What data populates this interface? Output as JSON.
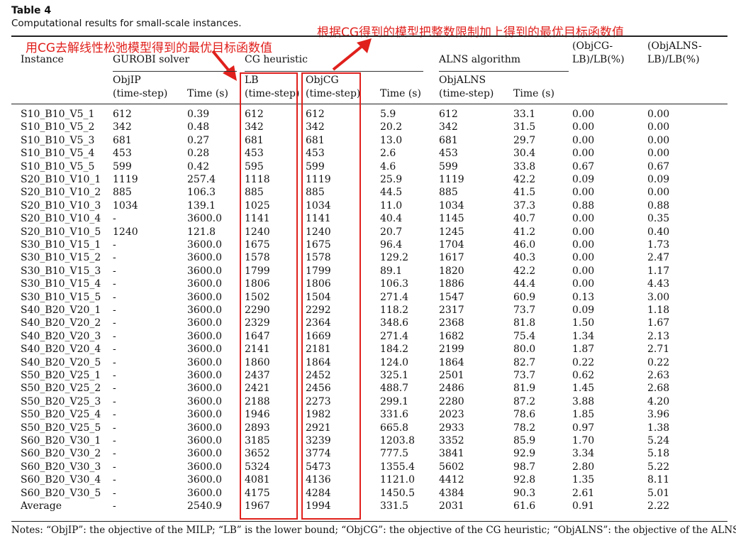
{
  "caption": {
    "label": "Table 4",
    "title": "Computational results for small-scale instances."
  },
  "annotations": {
    "left": "用CG去解线性松弛模型得到的最优目标函数值",
    "right": "根据CG得到的模型把整数限制加上得到的最优目标函数值",
    "color": "#e0201c"
  },
  "header": {
    "instance": "Instance",
    "gurobi": "GUROBI solver",
    "cg": "CG heuristic",
    "alns": "ALNS algorithm",
    "gap_cg_l1": "(ObjCG-",
    "gap_cg_l2": "LB)/LB(%)",
    "gap_alns_l1": "(ObjALNS-",
    "gap_alns_l2": "LB)/LB(%)",
    "objip_l1": "ObjIP",
    "objip_l2": "(time-step)",
    "time": "Time (s)",
    "lb_l1": "LB",
    "lb_l2": "(time-step)",
    "objcg_l1": "ObjCG",
    "objcg_l2": "(time-step)",
    "objalns_l1": "ObjALNS",
    "objalns_l2": "(time-step)"
  },
  "chart_data": {
    "type": "table",
    "title": "Computational results for small-scale instances.",
    "columns": [
      "Instance",
      "ObjIP (time-step)",
      "Time (s)",
      "LB (time-step)",
      "ObjCG (time-step)",
      "Time (s)",
      "ObjALNS (time-step)",
      "Time (s)",
      "(ObjCG-LB)/LB(%)",
      "(ObjALNS-LB)/LB(%)"
    ],
    "rows": [
      [
        "S10_B10_V5_1",
        "612",
        "0.39",
        "612",
        "612",
        "5.9",
        "612",
        "33.1",
        "0.00",
        "0.00"
      ],
      [
        "S10_B10_V5_2",
        "342",
        "0.48",
        "342",
        "342",
        "20.2",
        "342",
        "31.5",
        "0.00",
        "0.00"
      ],
      [
        "S10_B10_V5_3",
        "681",
        "0.27",
        "681",
        "681",
        "13.0",
        "681",
        "29.7",
        "0.00",
        "0.00"
      ],
      [
        "S10_B10_V5_4",
        "453",
        "0.28",
        "453",
        "453",
        "2.6",
        "453",
        "30.4",
        "0.00",
        "0.00"
      ],
      [
        "S10_B10_V5_5",
        "599",
        "0.42",
        "595",
        "599",
        "4.6",
        "599",
        "33.8",
        "0.67",
        "0.67"
      ],
      [
        "S20_B10_V10_1",
        "1119",
        "257.4",
        "1118",
        "1119",
        "25.9",
        "1119",
        "42.2",
        "0.09",
        "0.09"
      ],
      [
        "S20_B10_V10_2",
        "885",
        "106.3",
        "885",
        "885",
        "44.5",
        "885",
        "41.5",
        "0.00",
        "0.00"
      ],
      [
        "S20_B10_V10_3",
        "1034",
        "139.1",
        "1025",
        "1034",
        "11.0",
        "1034",
        "37.3",
        "0.88",
        "0.88"
      ],
      [
        "S20_B10_V10_4",
        "-",
        "3600.0",
        "1141",
        "1141",
        "40.4",
        "1145",
        "40.7",
        "0.00",
        "0.35"
      ],
      [
        "S20_B10_V10_5",
        "1240",
        "121.8",
        "1240",
        "1240",
        "20.7",
        "1245",
        "41.2",
        "0.00",
        "0.40"
      ],
      [
        "S30_B10_V15_1",
        "-",
        "3600.0",
        "1675",
        "1675",
        "96.4",
        "1704",
        "46.0",
        "0.00",
        "1.73"
      ],
      [
        "S30_B10_V15_2",
        "-",
        "3600.0",
        "1578",
        "1578",
        "129.2",
        "1617",
        "40.3",
        "0.00",
        "2.47"
      ],
      [
        "S30_B10_V15_3",
        "-",
        "3600.0",
        "1799",
        "1799",
        "89.1",
        "1820",
        "42.2",
        "0.00",
        "1.17"
      ],
      [
        "S30_B10_V15_4",
        "-",
        "3600.0",
        "1806",
        "1806",
        "106.3",
        "1886",
        "44.4",
        "0.00",
        "4.43"
      ],
      [
        "S30_B10_V15_5",
        "-",
        "3600.0",
        "1502",
        "1504",
        "271.4",
        "1547",
        "60.9",
        "0.13",
        "3.00"
      ],
      [
        "S40_B20_V20_1",
        "-",
        "3600.0",
        "2290",
        "2292",
        "118.2",
        "2317",
        "73.7",
        "0.09",
        "1.18"
      ],
      [
        "S40_B20_V20_2",
        "-",
        "3600.0",
        "2329",
        "2364",
        "348.6",
        "2368",
        "81.8",
        "1.50",
        "1.67"
      ],
      [
        "S40_B20_V20_3",
        "-",
        "3600.0",
        "1647",
        "1669",
        "271.4",
        "1682",
        "75.4",
        "1.34",
        "2.13"
      ],
      [
        "S40_B20_V20_4",
        "-",
        "3600.0",
        "2141",
        "2181",
        "184.2",
        "2199",
        "80.0",
        "1.87",
        "2.71"
      ],
      [
        "S40_B20_V20_5",
        "-",
        "3600.0",
        "1860",
        "1864",
        "124.0",
        "1864",
        "82.7",
        "0.22",
        "0.22"
      ],
      [
        "S50_B20_V25_1",
        "-",
        "3600.0",
        "2437",
        "2452",
        "325.1",
        "2501",
        "73.7",
        "0.62",
        "2.63"
      ],
      [
        "S50_B20_V25_2",
        "-",
        "3600.0",
        "2421",
        "2456",
        "488.7",
        "2486",
        "81.9",
        "1.45",
        "2.68"
      ],
      [
        "S50_B20_V25_3",
        "-",
        "3600.0",
        "2188",
        "2273",
        "299.1",
        "2280",
        "87.2",
        "3.88",
        "4.20"
      ],
      [
        "S50_B20_V25_4",
        "-",
        "3600.0",
        "1946",
        "1982",
        "331.6",
        "2023",
        "78.6",
        "1.85",
        "3.96"
      ],
      [
        "S50_B20_V25_5",
        "-",
        "3600.0",
        "2893",
        "2921",
        "665.8",
        "2933",
        "78.2",
        "0.97",
        "1.38"
      ],
      [
        "S60_B20_V30_1",
        "-",
        "3600.0",
        "3185",
        "3239",
        "1203.8",
        "3352",
        "85.9",
        "1.70",
        "5.24"
      ],
      [
        "S60_B20_V30_2",
        "-",
        "3600.0",
        "3652",
        "3774",
        "777.5",
        "3841",
        "92.9",
        "3.34",
        "5.18"
      ],
      [
        "S60_B20_V30_3",
        "-",
        "3600.0",
        "5324",
        "5473",
        "1355.4",
        "5602",
        "98.7",
        "2.80",
        "5.22"
      ],
      [
        "S60_B20_V30_4",
        "-",
        "3600.0",
        "4081",
        "4136",
        "1121.0",
        "4412",
        "92.8",
        "1.35",
        "8.11"
      ],
      [
        "S60_B20_V30_5",
        "-",
        "3600.0",
        "4175",
        "4284",
        "1450.5",
        "4384",
        "90.3",
        "2.61",
        "5.01"
      ],
      [
        "Average",
        "-",
        "2540.9",
        "1967",
        "1994",
        "331.5",
        "2031",
        "61.6",
        "0.91",
        "2.22"
      ]
    ]
  },
  "notes": "Notes: “ObjIP”: the objective of the MILP; “LB” is the lower bound; “ObjCG”: the objective of the CG heuristic; “ObjALNS”: the objective of the ALNS."
}
